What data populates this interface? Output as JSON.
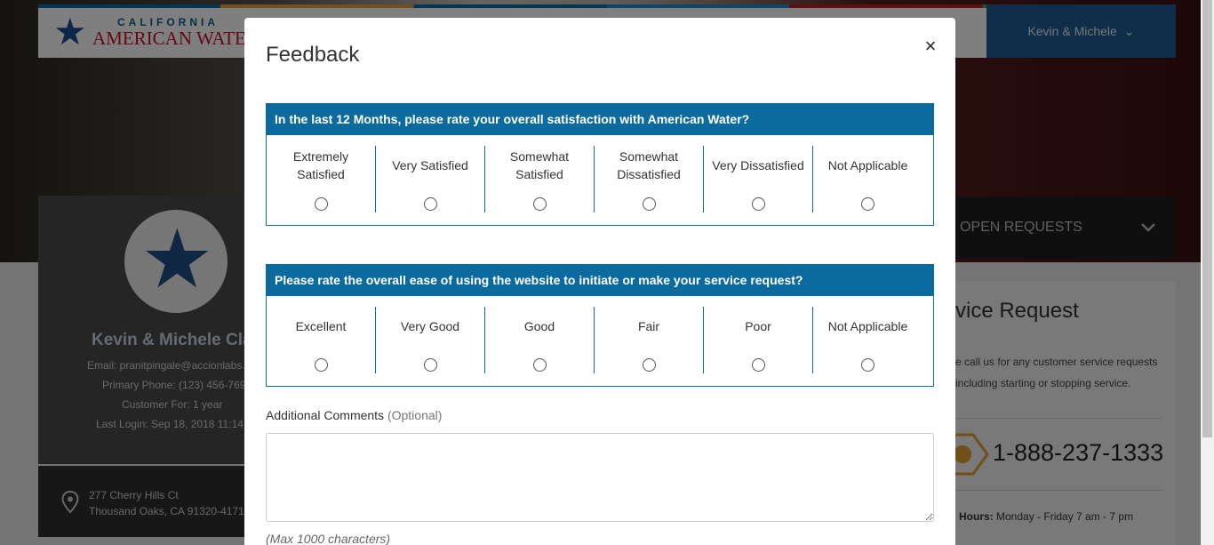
{
  "background": {
    "logo": {
      "line1": "CALIFORNIA",
      "line2": "AMERICAN WATER"
    },
    "user_menu": {
      "label": "Kevin & Michele",
      "chevron": "⌄"
    },
    "profile": {
      "name": "Kevin & Michele Cla",
      "email": "Email: pranitpingale@accionlabs.",
      "phone": "Primary Phone: (123) 456-769",
      "customer_for": "Customer For: 1 year",
      "last_login": "Last Login: Sep 18, 2018 11:14:"
    },
    "address": {
      "line1": "277 Cherry Hills Ct",
      "line2": "Thousand Oaks, CA 91320-4171"
    },
    "open_requests": {
      "label": "OPEN REQUESTS",
      "chevron": "⌄"
    },
    "service": {
      "title": "vice Request",
      "text": "e call us for any customer service requests including starting or stopping service.",
      "phone": "1-888-237-1333",
      "hours_label": "Hours:",
      "hours_value": "Monday - Friday 7 am - 7 pm"
    }
  },
  "modal": {
    "title": "Feedback",
    "close_glyph": "×",
    "questions": [
      {
        "text": "In the last 12 Months, please rate your overall satisfaction with American Water?",
        "options": [
          "Extremely Satisfied",
          "Very Satisfied",
          "Somewhat Satisfied",
          "Somewhat Dissatisfied",
          "Very Dissatisfied",
          "Not Applicable"
        ]
      },
      {
        "text": "Please rate the overall ease of using the website to initiate or make your service request?",
        "options": [
          "Excellent",
          "Very Good",
          "Good",
          "Fair",
          "Poor",
          "Not Applicable"
        ]
      }
    ],
    "comments": {
      "label": "Additional Comments",
      "optional": "(Optional)",
      "value": "",
      "max_note": "(Max 1000 characters)"
    }
  },
  "colors": {
    "accent": "#0b6a9e",
    "overlay": "rgba(0,0,0,0.5)",
    "brand_red": "#c8102e",
    "brand_blue": "#1d5d95"
  }
}
